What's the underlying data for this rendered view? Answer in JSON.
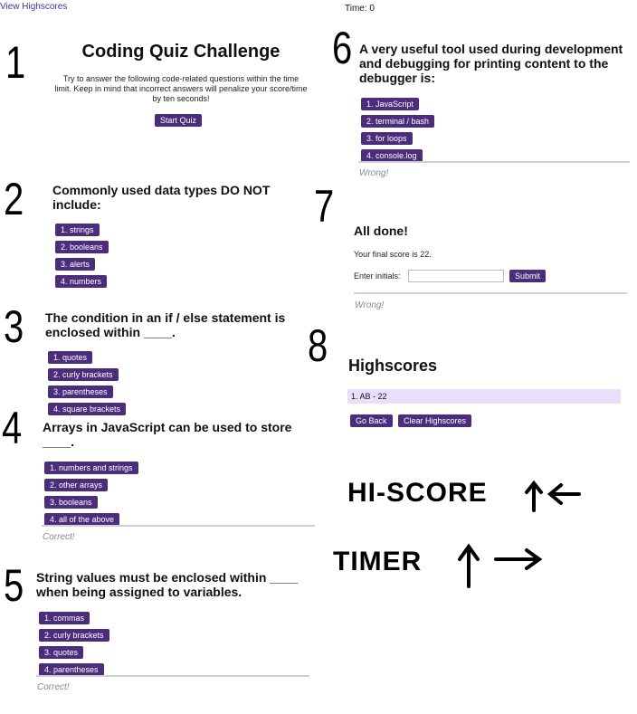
{
  "header": {
    "view_highscores": "View Highscores",
    "time": "Time: 0"
  },
  "panel1": {
    "number": "1",
    "title": "Coding Quiz Challenge",
    "intro_lines": [
      "Try to answer the following code-related questions within the time",
      "limit. Keep in mind that incorrect answers will penalize your score/time",
      "by ten seconds!"
    ],
    "start_button": "Start Quiz"
  },
  "panel2": {
    "number": "2",
    "question_lines": [
      "Commonly used data types DO NOT",
      "include:"
    ],
    "answers": [
      "1. strings",
      "2. booleans",
      "3. alerts",
      "4. numbers"
    ]
  },
  "panel3": {
    "number": "3",
    "question_lines": [
      "The condition in an if / else statement is",
      "enclosed within ____."
    ],
    "answers": [
      "1. quotes",
      "2. curly brackets",
      "3. parentheses",
      "4. square brackets"
    ]
  },
  "panel4": {
    "number": "4",
    "question_lines": [
      "Arrays in JavaScript can be used to store",
      "____."
    ],
    "answers": [
      "1. numbers and strings",
      "2. other arrays",
      "3. booleans",
      "4. all of the above"
    ],
    "feedback": "Correct!"
  },
  "panel5": {
    "number": "5",
    "question_lines": [
      "String values must be enclosed within ____",
      "when being assigned to variables."
    ],
    "answers": [
      "1. commas",
      "2. curly brackets",
      "3. quotes",
      "4. parentheses"
    ],
    "feedback": "Correct!"
  },
  "panel6": {
    "number": "6",
    "question_lines": [
      "A very useful tool used during development",
      "and debugging for printing content to the",
      "debugger is:"
    ],
    "answers": [
      "1. JavaScript",
      "2. terminal / bash",
      "3. for loops",
      "4. console.log"
    ],
    "feedback": "Wrong!"
  },
  "panel7": {
    "number": "7",
    "title": "All done!",
    "score_text": "Your final score is 22.",
    "initials_label": "Enter initials:",
    "initials_value": "",
    "submit": "Submit",
    "feedback": "Wrong!"
  },
  "panel8": {
    "number": "8",
    "title": "Highscores",
    "entries": [
      "1. AB - 22"
    ],
    "go_back": "Go Back",
    "clear": "Clear Highscores"
  },
  "annotations": {
    "hiscore": "HI-SCORE",
    "timer": "TIMER"
  }
}
